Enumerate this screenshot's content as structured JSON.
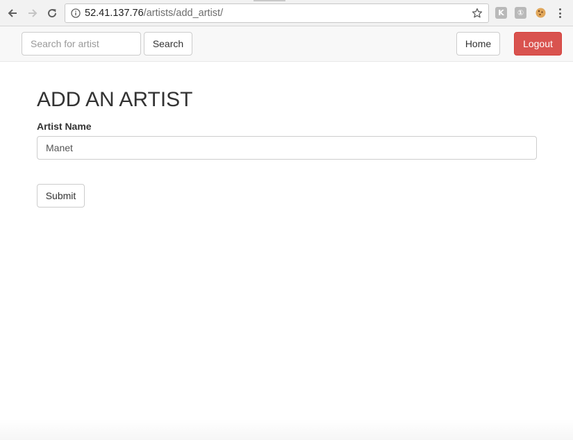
{
  "browser": {
    "url_host": "52.41.137.76",
    "url_path": "/artists/add_artist/",
    "extensions": [
      {
        "name": "k-extension-icon",
        "glyph": "K"
      },
      {
        "name": "person-extension-icon",
        "glyph": "①"
      }
    ]
  },
  "navbar": {
    "search_placeholder": "Search for artist",
    "search_label": "Search",
    "home_label": "Home",
    "logout_label": "Logout"
  },
  "form": {
    "title": "ADD AN ARTIST",
    "artist_name_label": "Artist Name",
    "artist_name_value": "Manet",
    "submit_label": "Submit"
  },
  "colors": {
    "danger": "#d9534f",
    "navbar_bg": "#f8f8f8"
  }
}
